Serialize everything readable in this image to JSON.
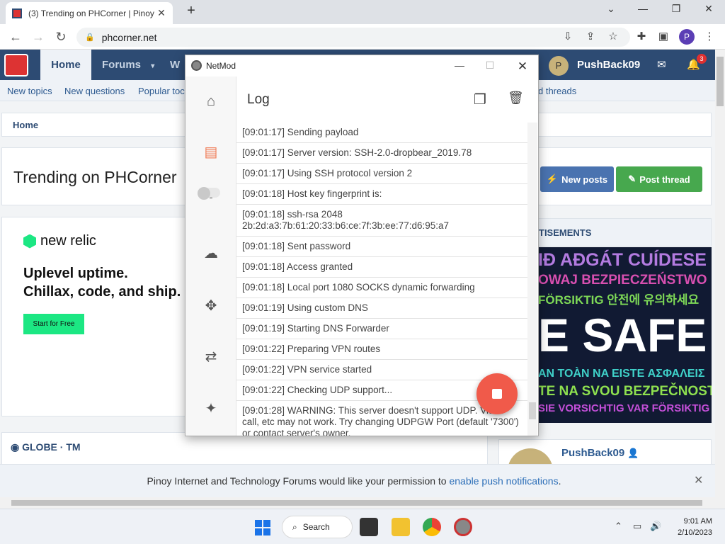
{
  "browser": {
    "tab_title": "(3) Trending on PHCorner | Pinoy",
    "url": "phcorner.net",
    "profile_initial": "P"
  },
  "site": {
    "nav": {
      "home": "Home",
      "forums": "Forums",
      "w_partial": "W",
      "username": "PushBack09",
      "avatar_initial": "P",
      "notification_count": "3"
    },
    "subnav": [
      "New topics",
      "New questions",
      "Popular toc",
      "d threads"
    ],
    "breadcrumb": "Home",
    "page_title": "Trending on PHCorner",
    "buttons": {
      "new_posts": "New posts",
      "post_thread": "Post thread"
    },
    "ad": {
      "brand": "new relic",
      "headline_1": "Uplevel uptime.",
      "headline_2": "Chillax, code, and ship.",
      "cta": "Start for Free"
    },
    "ads_header": "TISEMENTS",
    "safe_banner": [
      {
        "text": "IÐ AÐGÁT CUÍDESE",
        "color": "#b37be0"
      },
      {
        "text": "OWAJ BEZPIECZEŃSTWO",
        "color": "#d84fb0"
      },
      {
        "text": "FÖRSIKTIG 안전에 유의하세요",
        "color": "#7ed957"
      },
      {
        "text": "E SAFE",
        "color": "#ffffff"
      },
      {
        "text": "AN TOÀN  NA EISTE ΑΣΦΑΛΕΙΣ",
        "color": "#3fd1c9"
      },
      {
        "text": "TE NA SVOU BEZPEČNOST",
        "color": "#8ee04f"
      },
      {
        "text": "SIE VORSICHTIG VAR FÖRSIKTIG",
        "color": "#c44fd8"
      }
    ],
    "globe_title": "GLOBE · TM",
    "profile_name": "PushBack09",
    "push_text": "Pinoy Internet and Technology Forums would like your permission to",
    "push_link": "enable push notifications",
    "push_period": "."
  },
  "netmod": {
    "title": "NetMod",
    "header": "Log",
    "log": [
      "[09:01:17] Sending payload",
      "[09:01:17] Server version: SSH-2.0-dropbear_2019.78",
      "[09:01:17] Using SSH protocol version 2",
      "[09:01:18] Host key fingerprint is:",
      "[09:01:18] ssh-rsa 2048 2b:2d:a3:7b:61:20:33:b6:ce:7f:3b:ee:77:d6:95:a7",
      "[09:01:18] Sent password",
      "[09:01:18] Access granted",
      "[09:01:18] Local port 1080 SOCKS dynamic forwarding",
      "[09:01:19] Using custom DNS",
      "[09:01:19] Starting DNS Forwarder",
      "[09:01:22] Preparing VPN routes",
      "[09:01:22] VPN service started",
      "[09:01:22] Checking UDP support...",
      "[09:01:28] WARNING: This server doesn't support UDP. Video call, etc may not work. Try changing UDPGW Port (default '7300') or contact server's owner."
    ]
  },
  "taskbar": {
    "search": "Search",
    "time": "9:01 AM",
    "date": "2/10/2023"
  }
}
